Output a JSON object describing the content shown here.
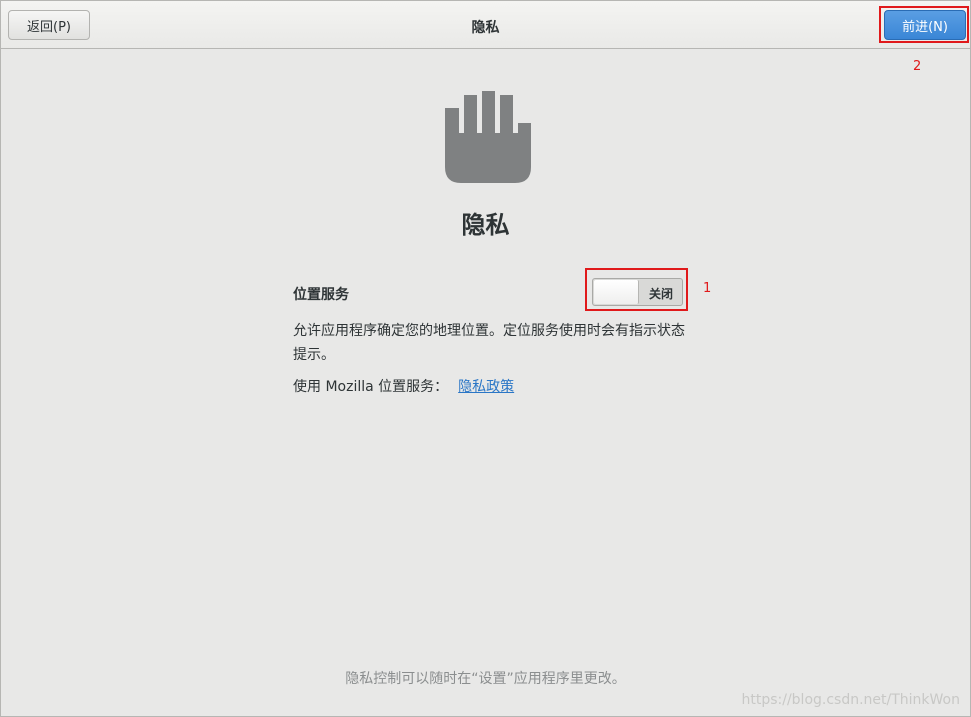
{
  "header": {
    "back_label": "返回(P)",
    "title": "隐私",
    "forward_label": "前进(N)"
  },
  "annotations": {
    "toggle_marker": "1",
    "forward_marker": "2",
    "marker_color": "#e0191b"
  },
  "page": {
    "icon": "hand-stop-icon",
    "heading": "隐私",
    "location_label": "位置服务",
    "switch_state": "关闭",
    "description": "允许应用程序确定您的地理位置。定位服务使用时会有指示状态提示。",
    "mozilla_text": "使用 Mozilla 位置服务：",
    "policy_link": "隐私政策",
    "footer_note": "隐私控制可以随时在“设置”应用程序里更改。",
    "watermark": "https://blog.csdn.net/ThinkWon"
  },
  "colors": {
    "accent": "#3a86d6",
    "background": "#e8e8e7",
    "link": "#2a76c6"
  }
}
